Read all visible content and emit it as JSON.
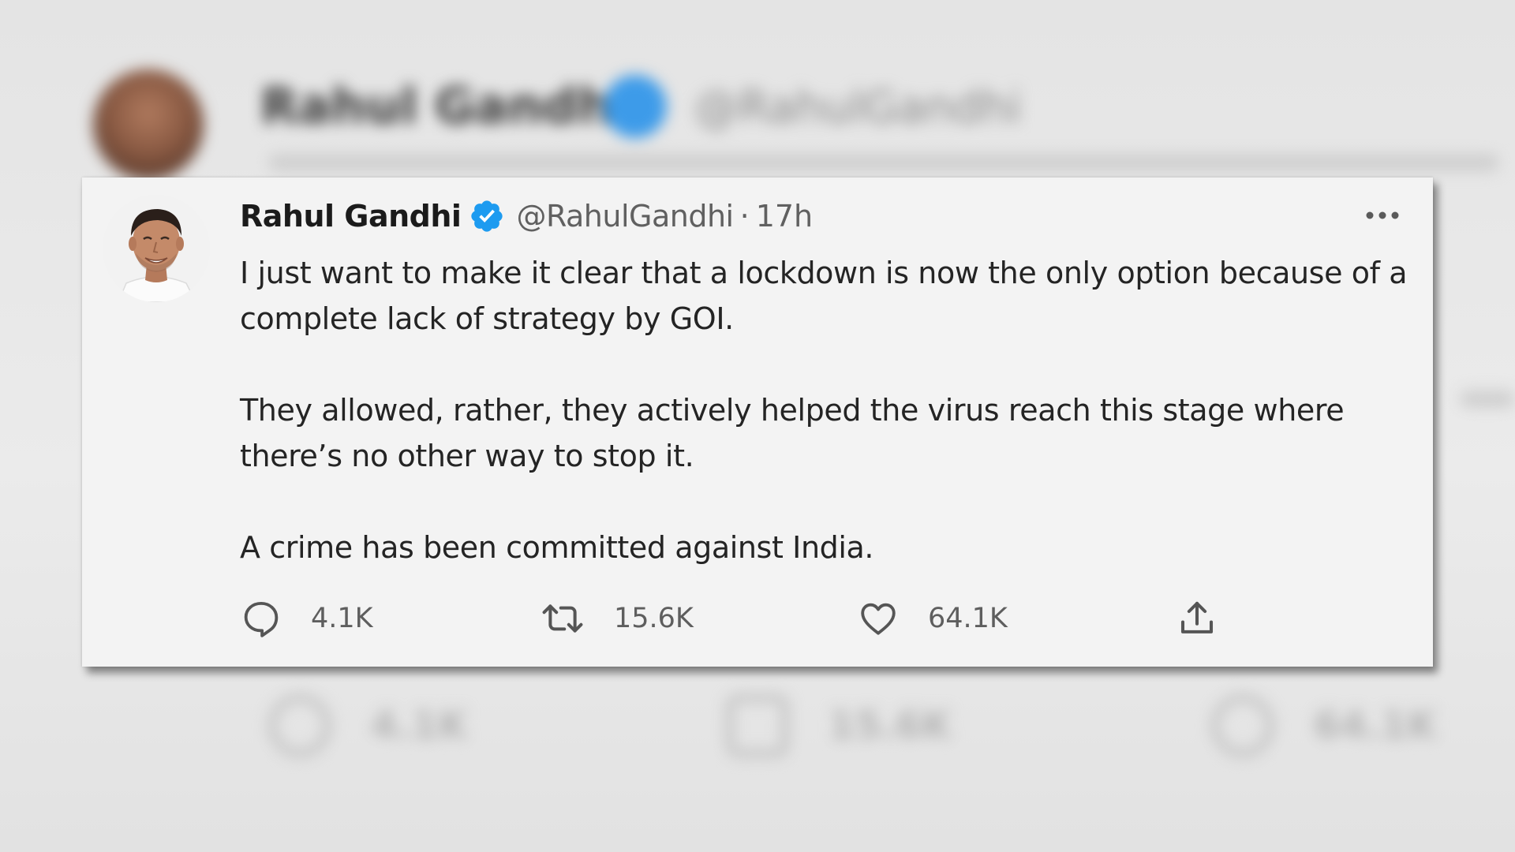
{
  "tweet": {
    "author_name": "Rahul Gandhi",
    "handle": "@RahulGandhi",
    "separator": "·",
    "time": "17h",
    "paragraphs": [
      "I just want to make it clear that a lockdown is now the only option because of a complete lack of strategy by GOI.",
      "They allowed, rather, they actively helped the virus reach this stage where there’s no other way to stop it.",
      "A crime has been committed against India."
    ],
    "actions": {
      "reply_count": "4.1K",
      "retweet_count": "15.6K",
      "like_count": "64.1K"
    }
  },
  "icons": {
    "verified": "verified-badge-icon",
    "more": "more-options-icon",
    "reply": "reply-icon",
    "retweet": "retweet-icon",
    "like": "like-icon",
    "share": "share-icon"
  },
  "colors": {
    "verified_blue": "#1d9bf0",
    "card_background": "#f3f3f3",
    "page_background": "#e6e6e6"
  }
}
